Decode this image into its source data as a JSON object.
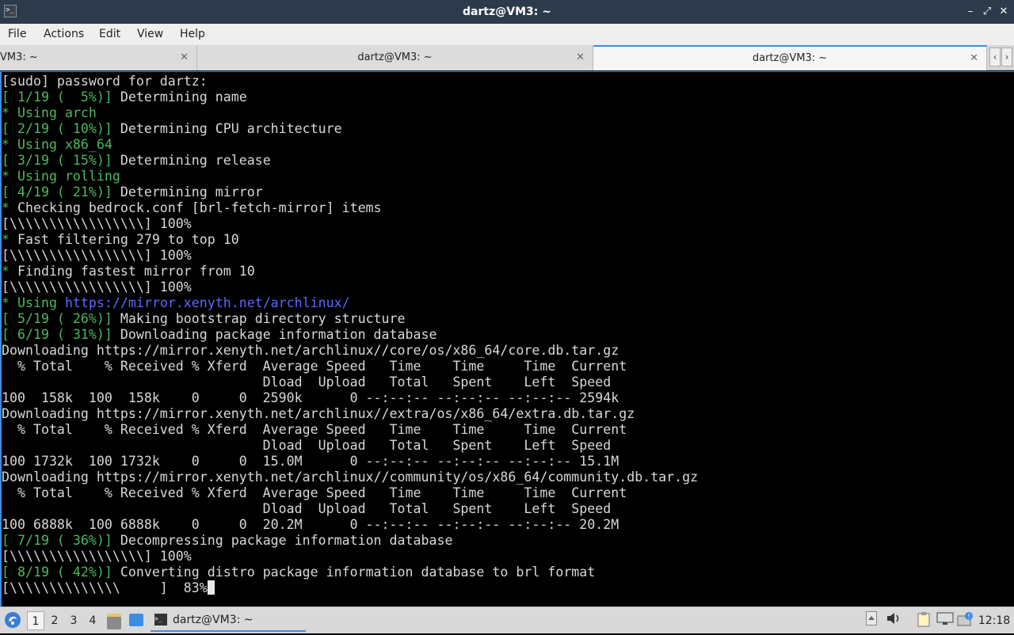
{
  "window": {
    "title": "dartz@VM3: ~",
    "minimize": "–",
    "maximize": "⤢",
    "close": "✕"
  },
  "menu": [
    "File",
    "Actions",
    "Edit",
    "View",
    "Help"
  ],
  "tabs": [
    {
      "label": "VM3: ~",
      "close": "✕",
      "active": false
    },
    {
      "label": "dartz@VM3: ~",
      "close": "✕",
      "active": false
    },
    {
      "label": "dartz@VM3: ~",
      "close": "✕",
      "active": true
    }
  ],
  "tab_nav": {
    "left": "‹",
    "right": "›"
  },
  "terminal": {
    "colors": {
      "green": "#4cb95a",
      "blue": "#5c68ff",
      "text": "#d8d8d8"
    },
    "lines": [
      [
        {
          "t": "[sudo] password for dartz:",
          "c": ""
        }
      ],
      [
        {
          "t": "[ 1/19 (  5%)]",
          "c": "g"
        },
        {
          "t": " Determining name",
          "c": ""
        }
      ],
      [
        {
          "t": "* Using ",
          "c": "g"
        },
        {
          "t": "arch",
          "c": "g"
        }
      ],
      [
        {
          "t": "[ 2/19 ( 10%)]",
          "c": "g"
        },
        {
          "t": " Determining CPU architecture",
          "c": ""
        }
      ],
      [
        {
          "t": "* Using ",
          "c": "g"
        },
        {
          "t": "x86_64",
          "c": "g"
        }
      ],
      [
        {
          "t": "[ 3/19 ( 15%)]",
          "c": "g"
        },
        {
          "t": " Determining release",
          "c": ""
        }
      ],
      [
        {
          "t": "* Using ",
          "c": "g"
        },
        {
          "t": "rolling",
          "c": "g"
        }
      ],
      [
        {
          "t": "[ 4/19 ( 21%)]",
          "c": "g"
        },
        {
          "t": " Determining mirror",
          "c": ""
        }
      ],
      [
        {
          "t": "* ",
          "c": "g"
        },
        {
          "t": "Checking bedrock.conf [brl-fetch-mirror] items",
          "c": ""
        }
      ],
      [
        {
          "t": "[\\\\\\\\\\\\\\\\\\\\\\\\\\\\\\\\\\] 100%",
          "c": ""
        }
      ],
      [
        {
          "t": "* ",
          "c": "g"
        },
        {
          "t": "Fast filtering 279 to top 10",
          "c": ""
        }
      ],
      [
        {
          "t": "[\\\\\\\\\\\\\\\\\\\\\\\\\\\\\\\\\\] 100%",
          "c": ""
        }
      ],
      [
        {
          "t": "* ",
          "c": "g"
        },
        {
          "t": "Finding fastest mirror from 10",
          "c": ""
        }
      ],
      [
        {
          "t": "[\\\\\\\\\\\\\\\\\\\\\\\\\\\\\\\\\\] 100%",
          "c": ""
        }
      ],
      [
        {
          "t": "* Using ",
          "c": "g"
        },
        {
          "t": "https://mirror.xenyth.net/archlinux/",
          "c": "b"
        }
      ],
      [
        {
          "t": "[ 5/19 ( 26%)]",
          "c": "g"
        },
        {
          "t": " Making bootstrap directory structure",
          "c": ""
        }
      ],
      [
        {
          "t": "[ 6/19 ( 31%)]",
          "c": "g"
        },
        {
          "t": " Downloading package information database",
          "c": ""
        }
      ],
      [
        {
          "t": "Downloading https://mirror.xenyth.net/archlinux//core/os/x86_64/core.db.tar.gz",
          "c": ""
        }
      ],
      [
        {
          "t": "  % Total    % Received % Xferd  Average Speed   Time    Time     Time  Current",
          "c": ""
        }
      ],
      [
        {
          "t": "                                 Dload  Upload   Total   Spent    Left  Speed",
          "c": ""
        }
      ],
      [
        {
          "t": "100  158k  100  158k    0     0  2590k      0 --:--:-- --:--:-- --:--:-- 2594k",
          "c": ""
        }
      ],
      [
        {
          "t": "Downloading https://mirror.xenyth.net/archlinux//extra/os/x86_64/extra.db.tar.gz",
          "c": ""
        }
      ],
      [
        {
          "t": "  % Total    % Received % Xferd  Average Speed   Time    Time     Time  Current",
          "c": ""
        }
      ],
      [
        {
          "t": "                                 Dload  Upload   Total   Spent    Left  Speed",
          "c": ""
        }
      ],
      [
        {
          "t": "100 1732k  100 1732k    0     0  15.0M      0 --:--:-- --:--:-- --:--:-- 15.1M",
          "c": ""
        }
      ],
      [
        {
          "t": "Downloading https://mirror.xenyth.net/archlinux//community/os/x86_64/community.db.tar.gz",
          "c": ""
        }
      ],
      [
        {
          "t": "  % Total    % Received % Xferd  Average Speed   Time    Time     Time  Current",
          "c": ""
        }
      ],
      [
        {
          "t": "                                 Dload  Upload   Total   Spent    Left  Speed",
          "c": ""
        }
      ],
      [
        {
          "t": "100 6888k  100 6888k    0     0  20.2M      0 --:--:-- --:--:-- --:--:-- 20.2M",
          "c": ""
        }
      ],
      [
        {
          "t": "[ 7/19 ( 36%)]",
          "c": "g"
        },
        {
          "t": " Decompressing package information database",
          "c": ""
        }
      ],
      [
        {
          "t": "[\\\\\\\\\\\\\\\\\\\\\\\\\\\\\\\\\\] 100%",
          "c": ""
        }
      ],
      [
        {
          "t": "[ 8/19 ( 42%)]",
          "c": "g"
        },
        {
          "t": " Converting distro package information database to brl format",
          "c": ""
        }
      ],
      [
        {
          "t": "[\\\\\\\\\\\\\\\\\\\\\\\\\\\\     ]  83%",
          "c": ""
        }
      ]
    ]
  },
  "taskbar": {
    "workspaces": [
      "1",
      "2",
      "3",
      "4"
    ],
    "active_workspace": "1",
    "task_label": "dartz@VM3: ~",
    "clock": "12:18"
  }
}
